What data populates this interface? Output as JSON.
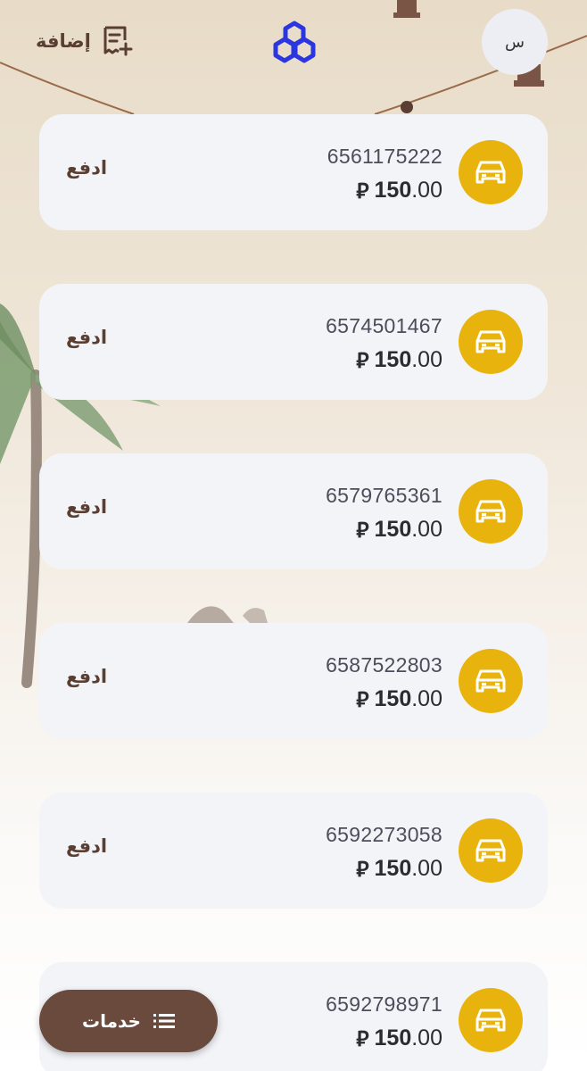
{
  "header": {
    "add_label": "إضافة",
    "avatar_letter": "س",
    "logo_icon": "bank-logo-icon"
  },
  "cards": [
    {
      "number": "6561175222",
      "amount_int": "150",
      "amount_dec": ".00",
      "currency": "⃁",
      "pay_label": "ادفع",
      "icon": "car-icon"
    },
    {
      "number": "6574501467",
      "amount_int": "150",
      "amount_dec": ".00",
      "currency": "⃁",
      "pay_label": "ادفع",
      "icon": "car-icon"
    },
    {
      "number": "6579765361",
      "amount_int": "150",
      "amount_dec": ".00",
      "currency": "⃁",
      "pay_label": "ادفع",
      "icon": "car-icon"
    },
    {
      "number": "6587522803",
      "amount_int": "150",
      "amount_dec": ".00",
      "currency": "⃁",
      "pay_label": "ادفع",
      "icon": "car-icon"
    },
    {
      "number": "6592273058",
      "amount_int": "150",
      "amount_dec": ".00",
      "currency": "⃁",
      "pay_label": "ادفع",
      "icon": "car-icon"
    },
    {
      "number": "6592798971",
      "amount_int": "150",
      "amount_dec": ".00",
      "currency": "⃁",
      "pay_label": "",
      "icon": "car-icon"
    }
  ],
  "services": {
    "label": "خدمات",
    "icon": "menu-list-icon"
  },
  "colors": {
    "accent_brown": "#6a4a3d",
    "icon_yellow": "#e8b30d",
    "logo_blue": "#2b35e0",
    "card_bg": "#f3f4f8"
  }
}
